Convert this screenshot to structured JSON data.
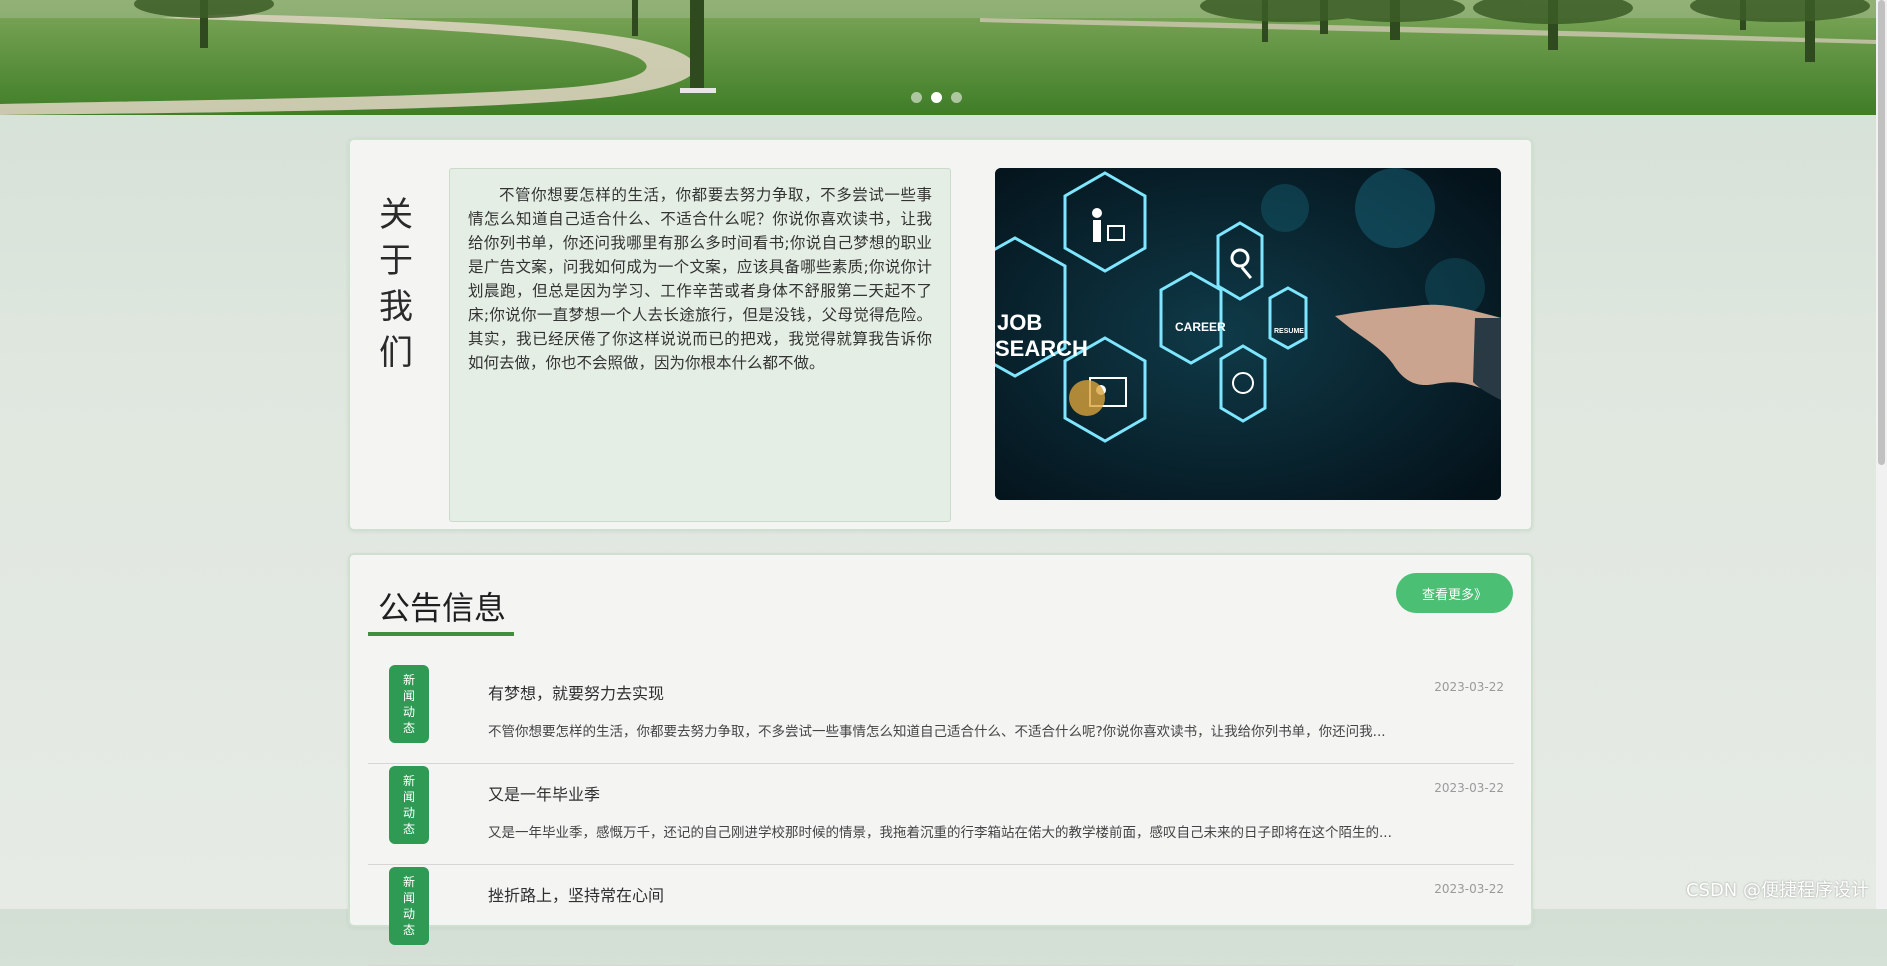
{
  "carousel": {
    "dots": 3,
    "active_index": 1
  },
  "about": {
    "title": "关于我们",
    "text": "不管你想要怎样的生活，你都要去努力争取，不多尝试一些事情怎么知道自己适合什么、不适合什么呢？你说你喜欢读书，让我给你列书单，你还问我哪里有那么多时间看书;你说自己梦想的职业是广告文案，问我如何成为一个文案，应该具备哪些素质;你说你计划晨跑，但总是因为学习、工作辛苦或者身体不舒服第二天起不了床;你说你一直梦想一个人去长途旅行，但是没钱，父母觉得危险。其实，我已经厌倦了你这样说说而已的把戏，我觉得就算我告诉你如何去做，你也不会照做，因为你根本什么都不做。",
    "image": {
      "labels": [
        "JOB",
        "SEARCH",
        "CAREER",
        "RESUME"
      ]
    }
  },
  "notice": {
    "title": "公告信息",
    "more_label": "查看更多》",
    "items": [
      {
        "tag": "新闻动态",
        "title": "有梦想，就要努力去实现",
        "date": "2023-03-22",
        "desc": "不管你想要怎样的生活，你都要去努力争取，不多尝试一些事情怎么知道自己适合什么、不适合什么呢?你说你喜欢读书，让我给你列书单，你还问我..."
      },
      {
        "tag": "新闻动态",
        "title": "又是一年毕业季",
        "date": "2023-03-22",
        "desc": "又是一年毕业季，感慨万千，还记的自己刚进学校那时候的情景，我拖着沉重的行李箱站在偌大的教学楼前面，感叹自己未来的日子即将在这个陌生的..."
      },
      {
        "tag": "新闻动态",
        "title": "挫折路上，坚持常在心间",
        "date": "2023-03-22",
        "desc": ""
      }
    ]
  },
  "watermark": "CSDN @便捷程序设计",
  "colors": {
    "accent_green": "#4bbf73",
    "tag_green": "#2e9a54",
    "underline_green": "#3f8f3f"
  }
}
